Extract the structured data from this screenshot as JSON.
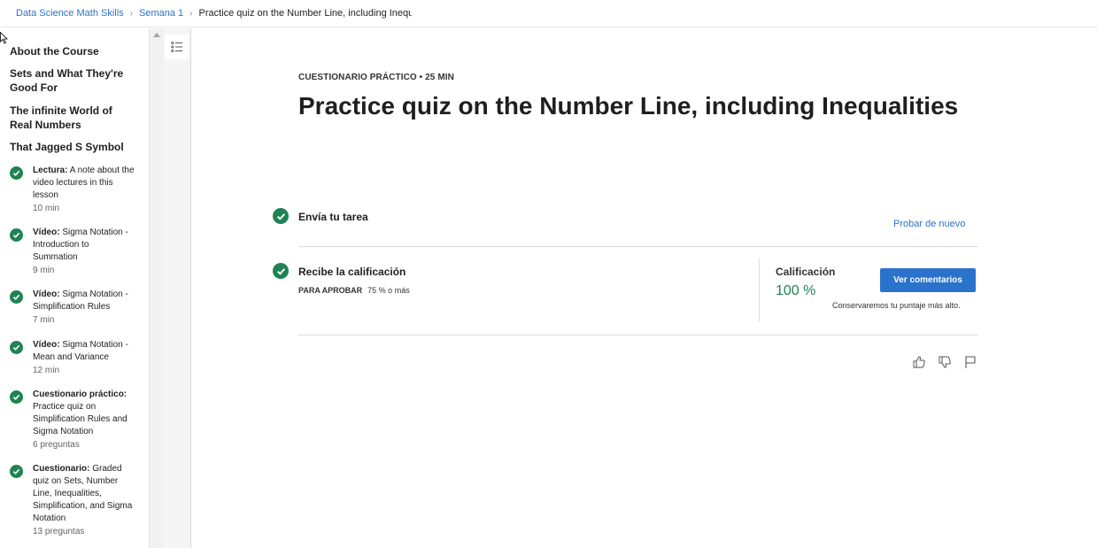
{
  "breadcrumb": {
    "items": [
      "Data Science Math Skills",
      "Semana 1"
    ],
    "current": "Practice quiz on the Number Line, including Inequalities"
  },
  "sidebar": {
    "sections": [
      {
        "title": "About the Course"
      },
      {
        "title": "Sets and What They're Good For"
      },
      {
        "title": "The infinite World of Real Numbers"
      },
      {
        "title": "That Jagged S Symbol"
      }
    ],
    "lessons": [
      {
        "type": "Lectura:",
        "name": "A note about the video lectures in this lesson",
        "meta": "10 min"
      },
      {
        "type": "Vídeo:",
        "name": "Sigma Notation - Introduction to Summation",
        "meta": "9 min"
      },
      {
        "type": "Vídeo:",
        "name": "Sigma Notation - Simplification Rules",
        "meta": "7 min"
      },
      {
        "type": "Vídeo:",
        "name": "Sigma Notation - Mean and Variance",
        "meta": "12 min"
      },
      {
        "type": "Cuestionario práctico:",
        "name": "Practice quiz on Simplification Rules and Sigma Notation",
        "meta": "6 preguntas"
      },
      {
        "type": "Cuestionario:",
        "name": "Graded quiz on Sets, Number Line, Inequalities, Simplification, and Sigma Notation",
        "meta": "13 preguntas"
      }
    ]
  },
  "main": {
    "kicker": "CUESTIONARIO PRÁCTICO • 25 MIN",
    "title": "Practice quiz on the Number Line, including Inequalities",
    "submit_step": {
      "label": "Envía tu tarea",
      "retry_label": "Probar de nuevo"
    },
    "grade_step": {
      "label": "Recibe la calificación",
      "pass_label": "PARA APROBAR",
      "pass_value": "75 % o más",
      "grade_label": "Calificación",
      "grade_value": "100 %",
      "feedback_button": "Ver comentarios",
      "keep_note": "Conservaremos tu puntaje más alto."
    },
    "actions": [
      "thumbs-up-icon",
      "thumbs-down-icon",
      "flag-icon"
    ]
  },
  "colors": {
    "accent": "#2a73cc",
    "success": "#1f8354"
  }
}
